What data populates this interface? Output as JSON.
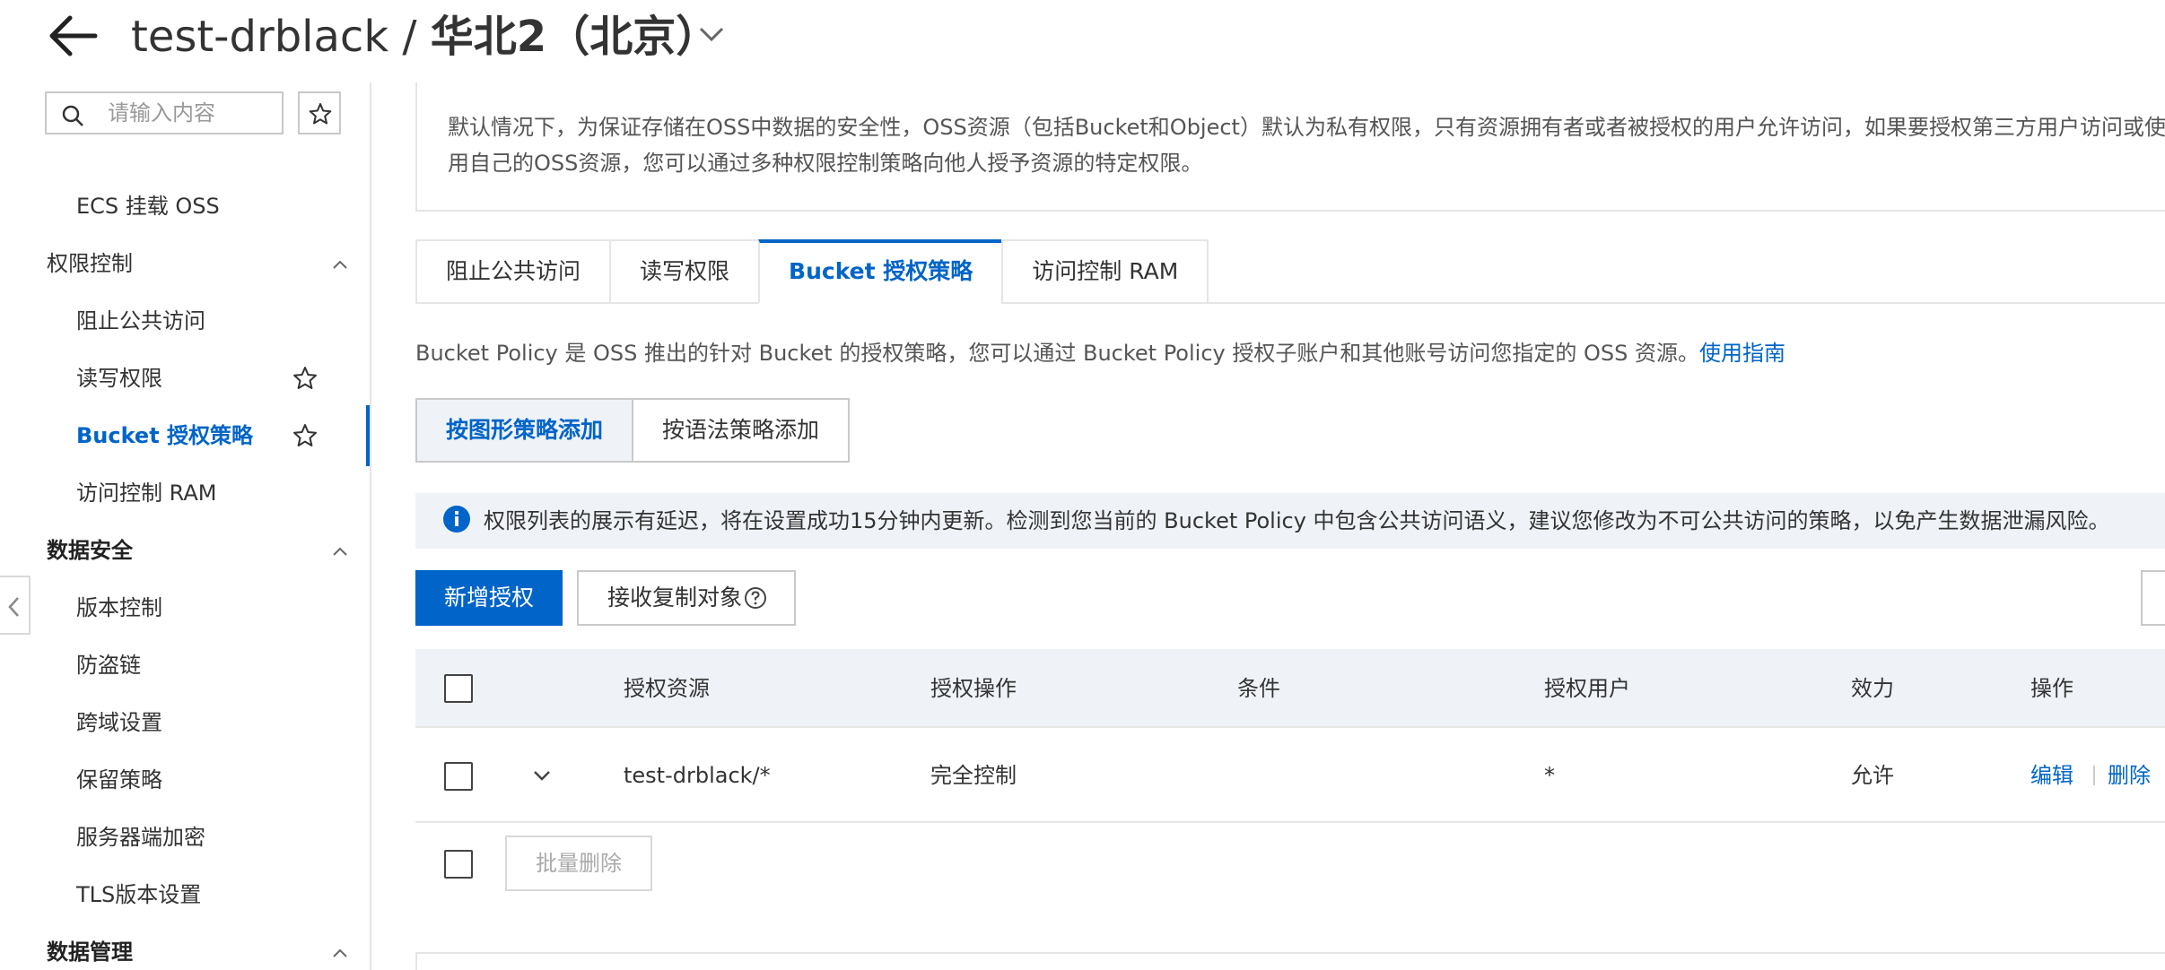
{
  "header": {
    "bucket": "test-drblack / ",
    "region": "华北2（北京）"
  },
  "sidebar": {
    "search_placeholder": "请输入内容",
    "items": [
      {
        "label": "ECS 挂载 OSS"
      },
      {
        "label": "权限控制"
      },
      {
        "label": "阻止公共访问"
      },
      {
        "label": "读写权限"
      },
      {
        "label": "Bucket 授权策略"
      },
      {
        "label": "访问控制 RAM"
      },
      {
        "label": "数据安全"
      },
      {
        "label": "版本控制"
      },
      {
        "label": "防盗链"
      },
      {
        "label": "跨域设置"
      },
      {
        "label": "保留策略"
      },
      {
        "label": "服务器端加密"
      },
      {
        "label": "TLS版本设置"
      },
      {
        "label": "数据管理"
      }
    ]
  },
  "info": {
    "text": "默认情况下，为保证存储在OSS中数据的安全性，OSS资源（包括Bucket和Object）默认为私有权限，只有资源拥有者或者被授权的用户允许访问，如果要授权第三方用户访问或使用自己的OSS资源，您可以通过多种权限控制策略向他人授予资源的特定权限。"
  },
  "tabs": [
    {
      "label": "阻止公共访问"
    },
    {
      "label": "读写权限"
    },
    {
      "label": "Bucket 授权策略"
    },
    {
      "label": "访问控制 RAM"
    }
  ],
  "description": {
    "text": "Bucket Policy 是 OSS 推出的针对 Bucket 的授权策略，您可以通过 Bucket Policy 授权子账户和其他账号访问您指定的 OSS 资源。",
    "link": "使用指南"
  },
  "mode": {
    "graphical": "按图形策略添加",
    "syntax": "按语法策略添加"
  },
  "notice": {
    "text": "权限列表的展示有延迟，将在设置成功15分钟内更新。检测到您当前的 Bucket Policy 中包含公共访问语义，建议您修改为不可公共访问的策略，以免产生数据泄漏风险。"
  },
  "actions": {
    "add": "新增授权",
    "receive": "接收复制对象"
  },
  "table": {
    "columns": [
      "授权资源",
      "授权操作",
      "条件",
      "授权用户",
      "效力",
      "操作"
    ],
    "rows": [
      {
        "resource": "test-drblack/*",
        "action": "完全控制",
        "condition": "",
        "principal": "*",
        "effect": "允许",
        "edit": "编辑",
        "delete": "删除"
      }
    ],
    "batch_delete": "批量删除"
  },
  "colors": {
    "accent": "#0064c8",
    "notice_bg": "#eff3f8"
  }
}
